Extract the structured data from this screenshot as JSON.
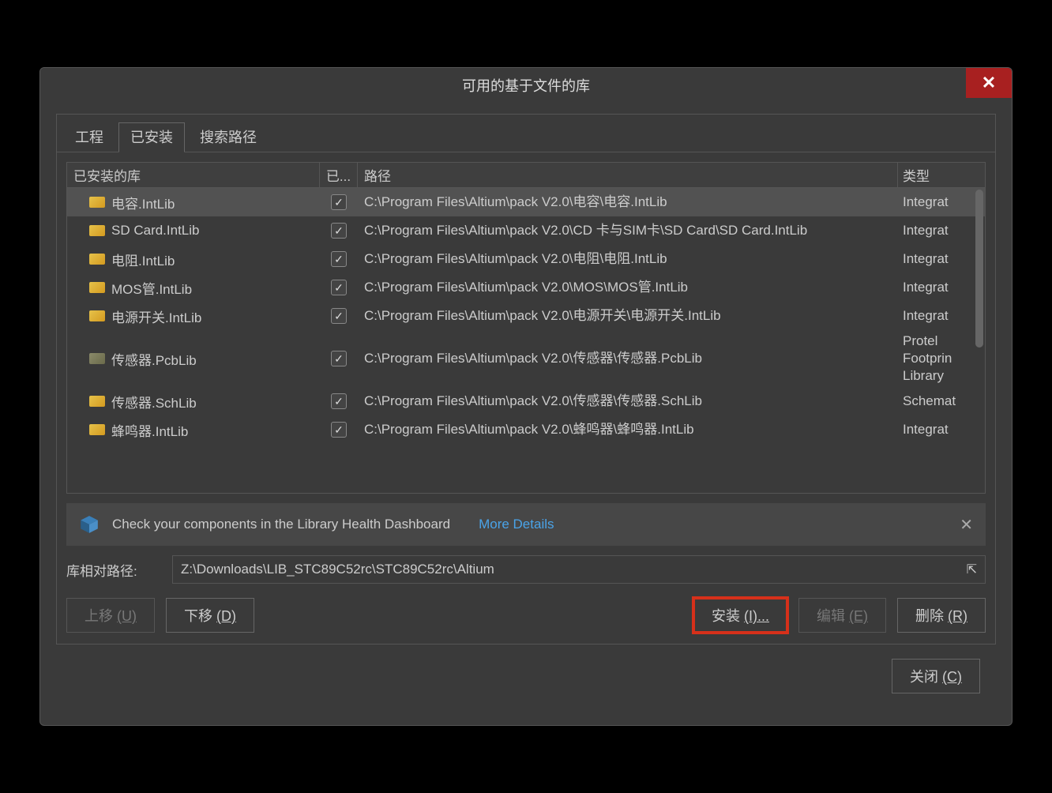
{
  "title": "可用的基于文件的库",
  "tabs": [
    "工程",
    "已安装",
    "搜索路径"
  ],
  "activeTab": 1,
  "columns": {
    "name": "已安装的库",
    "enabled": "已...",
    "path": "路径",
    "type": "类型"
  },
  "rows": [
    {
      "name": "电容.IntLib",
      "checked": true,
      "path": "C:\\Program Files\\Altium\\pack V2.0\\电容\\电容.IntLib",
      "type": "Integrat",
      "selected": true,
      "icon": "lib"
    },
    {
      "name": "SD Card.IntLib",
      "checked": true,
      "path": "C:\\Program Files\\Altium\\pack V2.0\\CD 卡与SIM卡\\SD Card\\SD Card.IntLib",
      "type": "Integrat",
      "icon": "lib"
    },
    {
      "name": "电阻.IntLib",
      "checked": true,
      "path": "C:\\Program Files\\Altium\\pack V2.0\\电阻\\电阻.IntLib",
      "type": "Integrat",
      "icon": "lib"
    },
    {
      "name": "MOS管.IntLib",
      "checked": true,
      "path": "C:\\Program Files\\Altium\\pack V2.0\\MOS\\MOS管.IntLib",
      "type": "Integrat",
      "icon": "lib"
    },
    {
      "name": "电源开关.IntLib",
      "checked": true,
      "path": "C:\\Program Files\\Altium\\pack V2.0\\电源开关\\电源开关.IntLib",
      "type": "Integrat",
      "icon": "lib"
    },
    {
      "name": "传感器.PcbLib",
      "checked": true,
      "path": "C:\\Program Files\\Altium\\pack V2.0\\传感器\\传感器.PcbLib",
      "type": "Protel Footprin Library",
      "icon": "pcb"
    },
    {
      "name": "传感器.SchLib",
      "checked": true,
      "path": "C:\\Program Files\\Altium\\pack V2.0\\传感器\\传感器.SchLib",
      "type": "Schemat",
      "icon": "lib"
    },
    {
      "name": "蜂鸣器.IntLib",
      "checked": true,
      "path": "C:\\Program Files\\Altium\\pack V2.0\\蜂鸣器\\蜂鸣器.IntLib",
      "type": "Integrat",
      "icon": "lib"
    }
  ],
  "banner": {
    "text": "Check your components in the Library Health Dashboard",
    "link": "More Details"
  },
  "pathLabel": "库相对路径:",
  "pathValue": "Z:\\Downloads\\LIB_STC89C52rc\\STC89C52rc\\Altium",
  "buttons": {
    "up": "上移 ",
    "upKey": "(U)",
    "down": "下移 ",
    "downKey": "(D)",
    "install": "安装 ",
    "installKey": "(I)...",
    "edit": "编辑 ",
    "editKey": "(E)",
    "delete": "删除 ",
    "deleteKey": "(R)",
    "close": "关闭 ",
    "closeKey": "(C)"
  }
}
